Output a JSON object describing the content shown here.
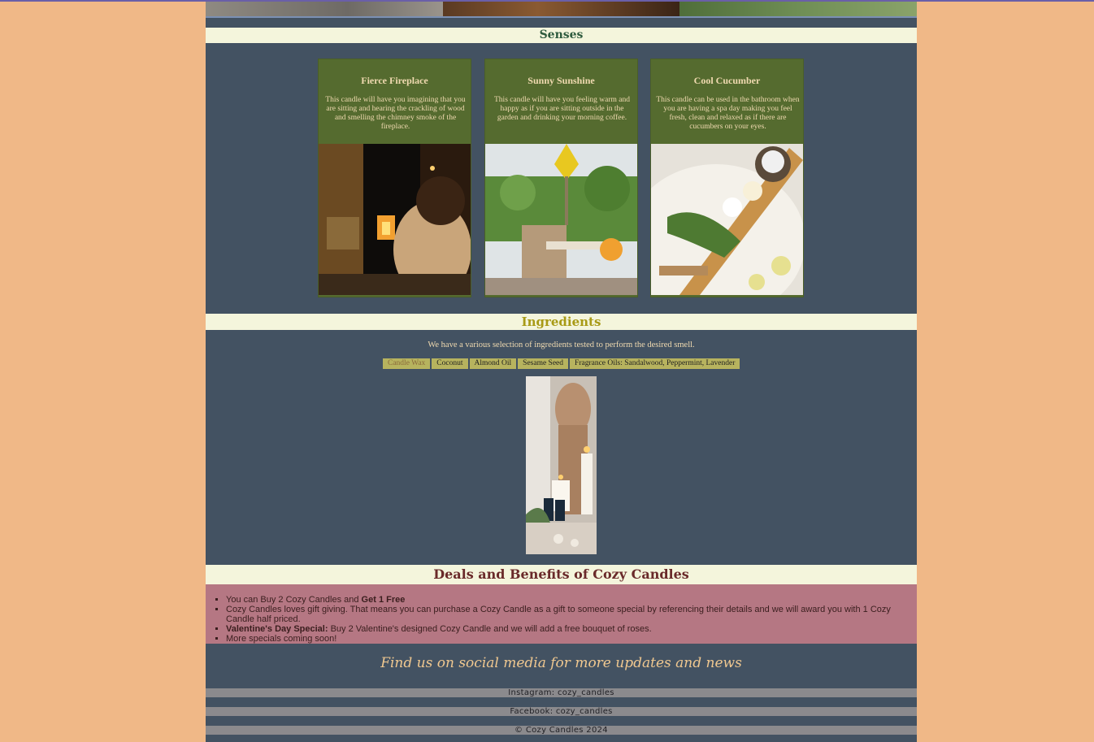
{
  "senses": {
    "heading": "Senses",
    "cards": [
      {
        "title": "Fierce Fireplace",
        "description": "This candle will have you imagining that you are sitting and hearing the crackling of wood and smelling the chimney smoke of the fireplace."
      },
      {
        "title": "Sunny Sunshine",
        "description": "This candle will have you feeling warm and happy as if you are sitting outside in the garden and drinking your morning coffee."
      },
      {
        "title": "Cool Cucumber",
        "description": "This candle can be used in the bathroom when you are having a spa day making you feel fresh, clean and relaxed as if there are cucumbers on your eyes."
      }
    ]
  },
  "ingredients": {
    "heading": "Ingredients",
    "intro": "We have a various selection of ingredients tested to perform the desired smell.",
    "tags": [
      "Candle Wax",
      "Coconut",
      "Almond Oil",
      "Sesame Seed",
      "Fragrance Oils: Sandalwood, Peppermint, Lavender"
    ]
  },
  "deals": {
    "heading": "Deals and Benefits of Cozy Candles",
    "item1_text": "You can Buy 2 Cozy Candles and ",
    "item1_bold": "Get 1 Free",
    "item2": "Cozy Candles loves gift giving. That means you can purchase a Cozy Candle as a gift to someone special by referencing their details and we will award you with 1 Cozy Candle half priced.",
    "item3_bold": "Valentine's Day Special:",
    "item3_text": " Buy 2 Valentine's designed Cozy Candle and we will add a free bouquet of roses.",
    "item4": "More specials coming soon!"
  },
  "social": {
    "heading": "Find us on social media for more updates and news",
    "instagram": "Instagram: cozy_candles",
    "facebook": "Facebook: cozy_candles",
    "copyright": "© Cozy Candles 2024"
  },
  "colors": {
    "background": "#f0b887",
    "panel": "#435262",
    "card": "#556b2f",
    "deals_bg": "#b57783",
    "band": "#f4f5dc"
  }
}
